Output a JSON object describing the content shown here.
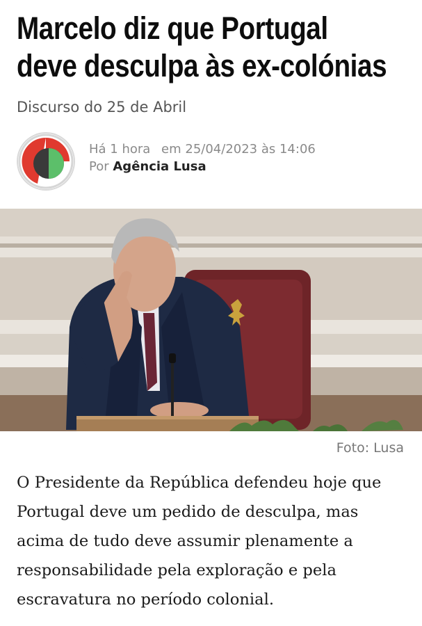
{
  "article": {
    "headline": {
      "line1": "Marcelo diz que Portugal",
      "line2": "deve desculpa às ex-colónias"
    },
    "subtitle": "Discurso do 25 de Abril",
    "meta": {
      "relative_time": "Há 1 hora",
      "date": "em 25/04/2023 às 14:06",
      "by_prefix": "Por",
      "author": "Agência Lusa"
    },
    "photo": {
      "icon": "news-photo",
      "caption": "Foto: Lusa"
    },
    "lead": "O Presidente da República defendeu hoje que Portugal deve um pedido de desculpa, mas acima de tudo deve assumir plenamente a responsabilidade pela exploração e pela escravatura no período colonial."
  },
  "colors": {
    "logo_red": "#e03a2f",
    "logo_dark": "#3a3a3a",
    "logo_green": "#5cbf6a"
  }
}
